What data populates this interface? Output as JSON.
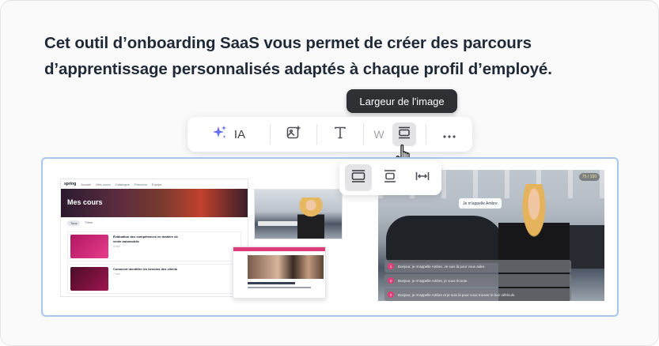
{
  "headline": {
    "line1": "Cet outil d’onboarding SaaS vous permet de créer des parcours",
    "line2": "d’apprentissage personnalisés adaptés à chaque profil d’employé."
  },
  "tooltip": {
    "label": "Largeur de l'image"
  },
  "toolbar": {
    "ia_label": "IA",
    "width_label": "W",
    "icons": [
      "sparkles-icon",
      "image-add-icon",
      "text-icon",
      "image-width-icon",
      "more-icon"
    ]
  },
  "width_menu": {
    "options": [
      "full-width-icon",
      "medium-width-icon",
      "fit-width-icon"
    ],
    "active_index": 0
  },
  "preview": {
    "app_logo": "spring",
    "app_nav": [
      "Accueil",
      "Mes cours",
      "Catalogue",
      "Parcours",
      "Équipe"
    ],
    "banner_title": "Mes cours",
    "filter_pill": "Tous",
    "filter_label": "Filtrer",
    "courses": [
      {
        "title": "Évaluation des compétences en matière de vente automobile",
        "subtitle": "5 min"
      },
      {
        "title": "Comment identifier les besoins des clients",
        "subtitle": "7 min"
      }
    ],
    "big_tag": "Je m'appelle Ambre",
    "big_badge": "75 / 100",
    "answers": [
      {
        "num": "1",
        "text": "Bonjour, je m'appelle Ambre. Je suis là pour vous aider."
      },
      {
        "num": "2",
        "text": "Bonjour, je m'appelle Ambre, je vous écoute."
      },
      {
        "num": "3",
        "text": "Bonjour, je m'appelle Ambre et je suis là pour vous trouver le bon véhicule."
      }
    ]
  },
  "colors": {
    "accent": "#e03c7a",
    "selection_border": "#a7c7ee",
    "tooltip_bg": "#2f3033",
    "ia_gradient": "#7c5cf5"
  }
}
